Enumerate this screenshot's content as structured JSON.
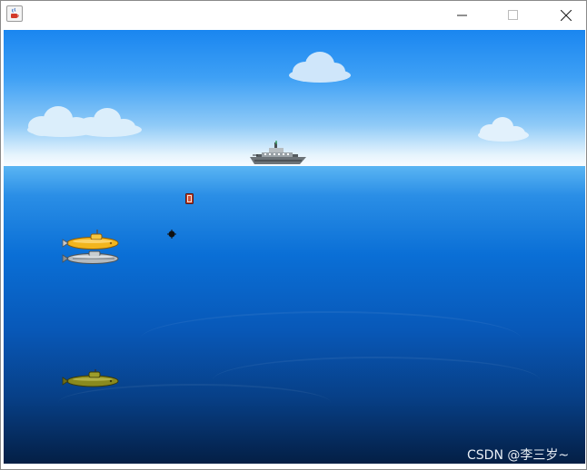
{
  "window": {
    "title": "",
    "app_icon": "java-cup-icon",
    "controls": {
      "minimize_icon": "minimize-icon",
      "maximize_icon": "maximize-icon",
      "close_icon": "close-icon"
    }
  },
  "game": {
    "scene": "submarine-battle",
    "colors": {
      "sky_top": "#1a86f0",
      "sky_horizon": "#f8fcff",
      "sea_surface": "#5ab5f3",
      "sea_deep": "#041f45"
    },
    "clouds": [
      "cloud-icon",
      "cloud-icon",
      "cloud-icon",
      "cloud-icon"
    ],
    "player_ship": "destroyer-ship-icon",
    "depth_charge": "depth-charge-icon",
    "mine": "mine-icon",
    "submarines": [
      "yellow-submarine-icon",
      "gray-submarine-icon",
      "olive-submarine-icon"
    ]
  },
  "watermark": "CSDN @李三岁~"
}
